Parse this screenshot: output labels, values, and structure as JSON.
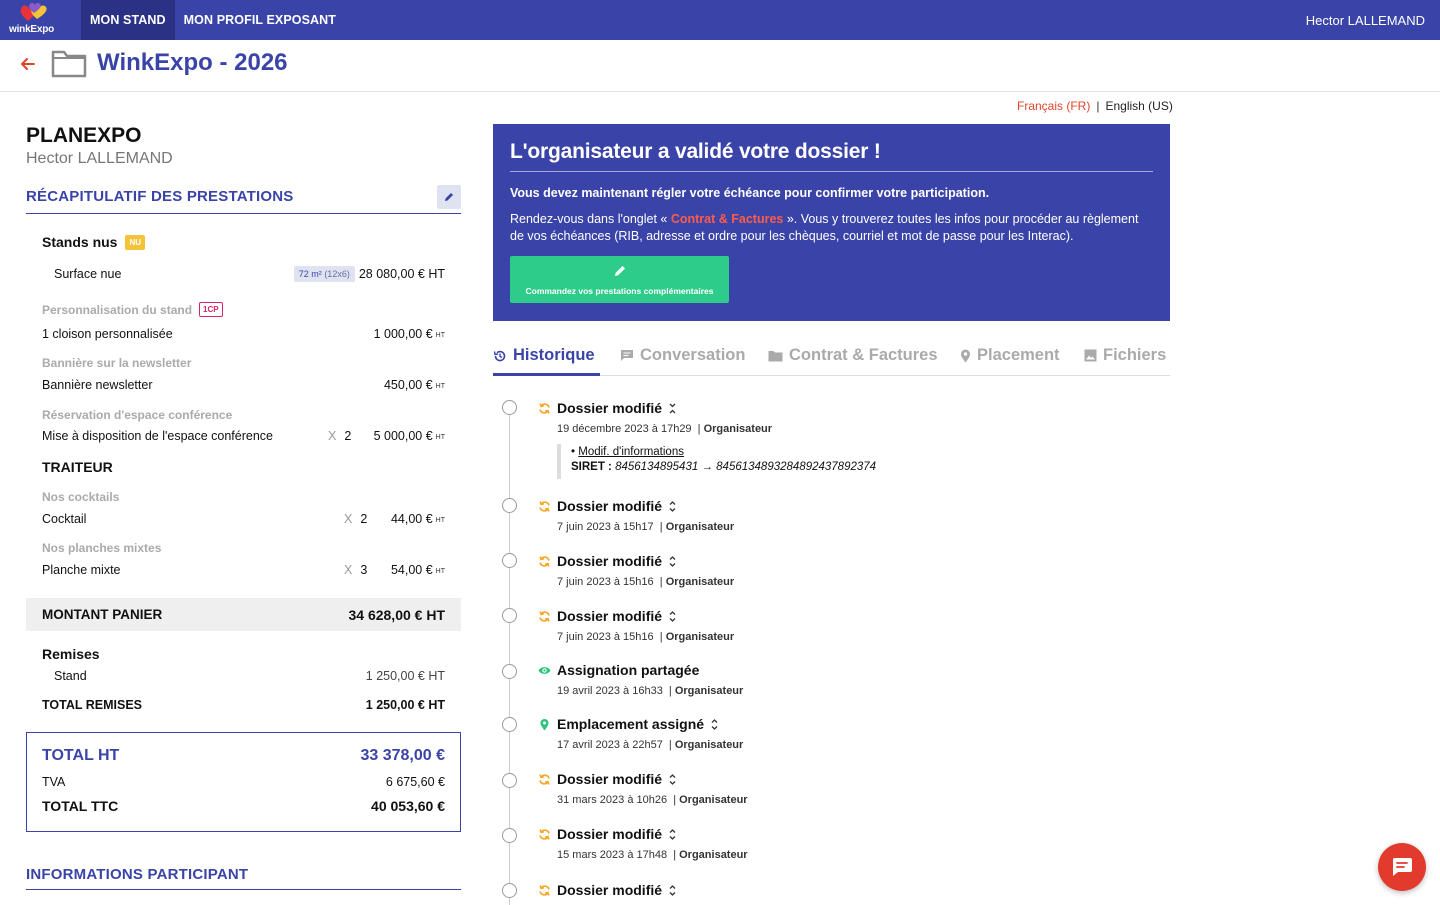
{
  "nav": {
    "logo_text": "winkExpo",
    "items": [
      {
        "label": "MON STAND"
      },
      {
        "label": "MON PROFIL EXPOSANT"
      }
    ],
    "user": "Hector LALLEMAND"
  },
  "header": {
    "title": "WinkExpo - 2026"
  },
  "lang": {
    "fr": "Français (FR)",
    "sep": "|",
    "en": "English (US)"
  },
  "left": {
    "company": "PLANEXPO",
    "contact": "Hector LALLEMAND",
    "recap_title": "RÉCAPITULATIF DES PRESTATIONS",
    "stands": {
      "title": "Stands nus",
      "badge": "NU",
      "item_label": "Surface nue",
      "chip_area": "72 m²",
      "chip_dims": "(12x6)",
      "item_amount": "28 080,00 € HT"
    },
    "categories": [
      {
        "name": "Personnalisation du stand",
        "badge": "1CP",
        "item": "1 cloison personnalisée",
        "qty_x": "",
        "qty": "",
        "amount": "1 000,00 €",
        "unit": "HT"
      },
      {
        "name": "Bannière sur la newsletter",
        "badge": "",
        "item": "Bannière newsletter",
        "qty_x": "",
        "qty": "",
        "amount": "450,00 €",
        "unit": "HT"
      },
      {
        "name": "Réservation d'espace conférence",
        "badge": "",
        "item": "Mise à disposition de l'espace conférence",
        "qty_x": "X",
        "qty": "2",
        "amount": "5 000,00 €",
        "unit": "HT"
      }
    ],
    "traiteur": {
      "title": "TRAITEUR",
      "items": [
        {
          "category": "Nos cocktails",
          "item": "Cocktail",
          "qty_x": "X",
          "qty": "2",
          "amount": "44,00 €",
          "unit": "HT"
        },
        {
          "category": "Nos planches mixtes",
          "item": "Planche mixte",
          "qty_x": "X",
          "qty": "3",
          "amount": "54,00 €",
          "unit": "HT"
        }
      ]
    },
    "panier": {
      "label": "MONTANT PANIER",
      "amount": "34 628,00 € HT"
    },
    "remises": {
      "title": "Remises",
      "item": "Stand",
      "item_amount": "1 250,00 € HT",
      "total_label": "TOTAL REMISES",
      "total_amount": "1 250,00 € HT"
    },
    "totals": {
      "ht_label": "TOTAL HT",
      "ht_amount": "33 378,00 €",
      "tva_label": "TVA",
      "tva_amount": "6 675,60 €",
      "ttc_label": "TOTAL TTC",
      "ttc_amount": "40 053,60 €"
    },
    "info_title": "INFORMATIONS PARTICIPANT"
  },
  "banner": {
    "title": "L'organisateur a validé votre dossier !",
    "p1": "Vous devez maintenant régler votre échéance pour confirmer votre participation.",
    "p2_before": "Rendez-vous dans l'onglet « ",
    "p2_link": "Contrat & Factures",
    "p2_after": " ». Vous y trouverez toutes les infos pour procéder au règlement de vos échéances (RIB, adresse et ordre pour les chèques, courriel et mot de passe pour les Interac).",
    "cta": "Commandez vos prestations complémentaires"
  },
  "tabs": [
    {
      "label": "Historique",
      "icon": "history-icon"
    },
    {
      "label": "Conversation",
      "icon": "chat-icon"
    },
    {
      "label": "Contrat & Factures",
      "icon": "folder-icon"
    },
    {
      "label": "Placement",
      "icon": "map-pin-icon"
    },
    {
      "label": "Fichiers",
      "icon": "image-icon"
    }
  ],
  "timeline": [
    {
      "title": "Dossier modifié",
      "date": "19 décembre 2023 à 17h29",
      "by": "Organisateur",
      "icon": "sync-icon",
      "toggle": "collapse"
    },
    {
      "title": "Dossier modifié",
      "date": "7 juin 2023 à 15h17",
      "by": "Organisateur",
      "icon": "sync-icon",
      "toggle": "expand"
    },
    {
      "title": "Dossier modifié",
      "date": "7 juin 2023 à 15h16",
      "by": "Organisateur",
      "icon": "sync-icon",
      "toggle": "expand"
    },
    {
      "title": "Dossier modifié",
      "date": "7 juin 2023 à 15h16",
      "by": "Organisateur",
      "icon": "sync-icon",
      "toggle": "expand"
    },
    {
      "title": "Assignation partagée",
      "date": "19 avril 2023 à 16h33",
      "by": "Organisateur",
      "icon": "eye-icon",
      "toggle": ""
    },
    {
      "title": "Emplacement assigné",
      "date": "17 avril 2023 à 22h57",
      "by": "Organisateur",
      "icon": "map-pin-icon",
      "toggle": "expand"
    },
    {
      "title": "Dossier modifié",
      "date": "31 mars 2023 à 10h26",
      "by": "Organisateur",
      "icon": "sync-icon",
      "toggle": "expand"
    },
    {
      "title": "Dossier modifié",
      "date": "15 mars 2023 à 17h48",
      "by": "Organisateur",
      "icon": "sync-icon",
      "toggle": "expand"
    },
    {
      "title": "Dossier modifié",
      "date": "",
      "by": "",
      "icon": "sync-icon",
      "toggle": "expand"
    }
  ],
  "detail": {
    "bullet": "•",
    "link": "Modif. d'informations",
    "field": "SIRET :",
    "old": "8456134895431",
    "arrow": "→",
    "new": "8456134893284892437892374"
  },
  "colors": {
    "primary": "#3a44a8",
    "nav_active": "#2b3285",
    "accent_red": "#e0452b",
    "cta_green": "#2ecc8a",
    "badge_yellow": "#f4c33a",
    "badge_pink": "#d6246e",
    "sync_orange": "#f5a623",
    "eye_green": "#2ec27e"
  }
}
